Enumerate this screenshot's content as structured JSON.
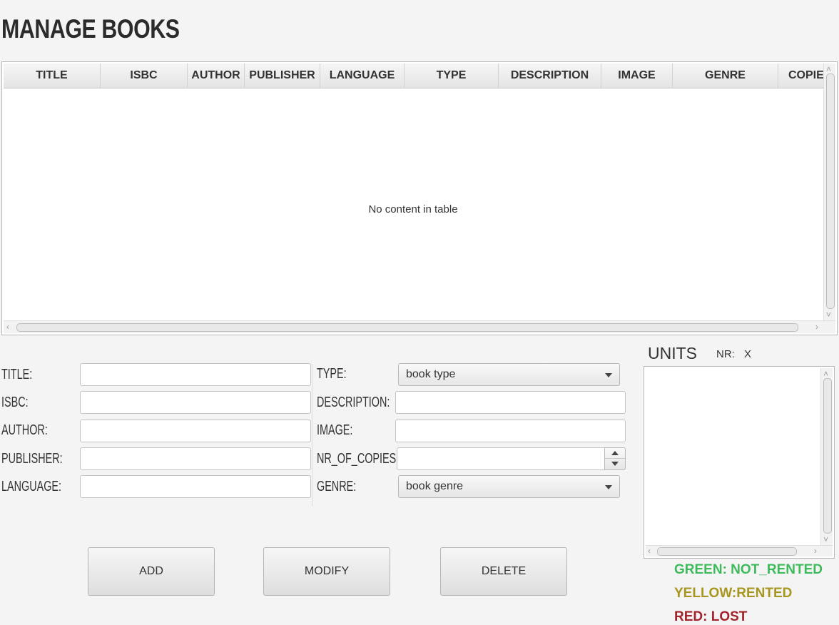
{
  "page": {
    "title": "MANAGE BOOKS"
  },
  "table": {
    "columns": [
      "TITLE",
      "ISBC",
      "AUTHOR",
      "PUBLISHER",
      "LANGUAGE",
      "TYPE",
      "DESCRIPTION",
      "IMAGE",
      "GENRE",
      "COPIES"
    ],
    "rows": [],
    "empty_message": "No content in table"
  },
  "form": {
    "labels": {
      "title": "TITLE:",
      "isbc": "ISBC:",
      "author": "AUTHOR:",
      "publisher": "PUBLISHER:",
      "language": "LANGUAGE:",
      "type": "TYPE:",
      "description": "DESCRIPTION:",
      "image": "IMAGE:",
      "nr_of_copies": "NR_OF_COPIES:",
      "genre": "GENRE:"
    },
    "values": {
      "title": "",
      "isbc": "",
      "author": "",
      "publisher": "",
      "language": "",
      "description": "",
      "image": "",
      "nr_of_copies": ""
    },
    "type_select": {
      "placeholder": "book type"
    },
    "genre_select": {
      "placeholder": "book genre"
    }
  },
  "buttons": {
    "add": "ADD",
    "modify": "MODIFY",
    "delete": "DELETE"
  },
  "units": {
    "title": "UNITS",
    "nr_label": "NR:",
    "nr_value": "X",
    "items": []
  },
  "legend": {
    "green": "GREEN: NOT_RENTED",
    "yellow": "YELLOW:RENTED",
    "red": "RED: LOST"
  },
  "colors": {
    "green": "#3dbb5a",
    "yellow": "#a8961f",
    "red": "#a3232b"
  }
}
